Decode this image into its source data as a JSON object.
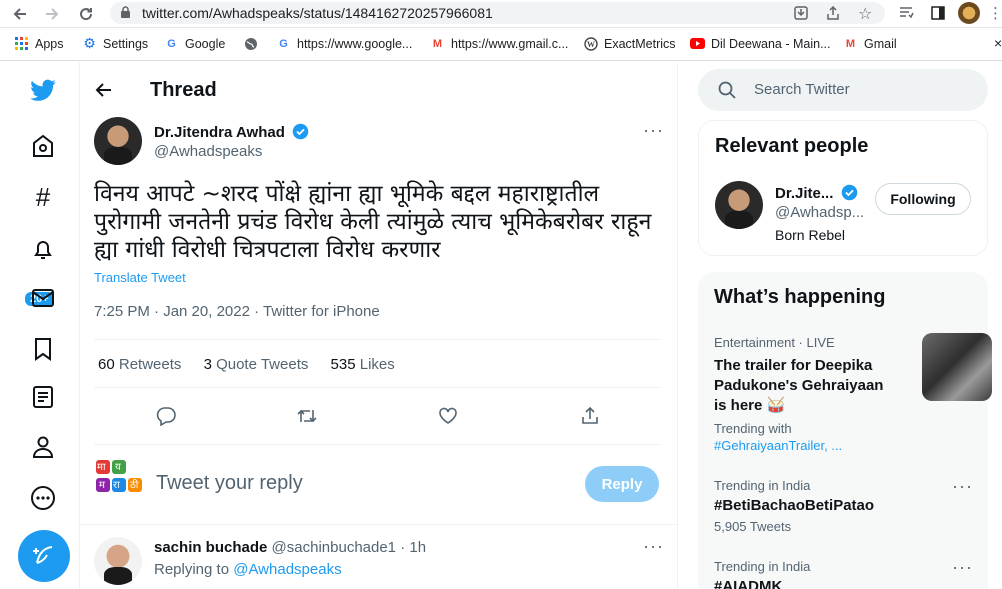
{
  "browser": {
    "url": "twitter.com/Awhadspeaks/status/1484162720257966081",
    "bookmarks": [
      {
        "label": "Apps",
        "icon": "apps-grid-icon"
      },
      {
        "label": "Settings",
        "icon": "gear-icon"
      },
      {
        "label": "Google",
        "icon": "google-icon"
      },
      {
        "label": "",
        "icon": "globe-icon"
      },
      {
        "label": "https://www.google...",
        "icon": "google-icon"
      },
      {
        "label": "https://www.gmail.c...",
        "icon": "gmail-icon"
      },
      {
        "label": "ExactMetrics",
        "icon": "wordpress-icon"
      },
      {
        "label": "Dil Deewana - Main...",
        "icon": "youtube-icon"
      },
      {
        "label": "Gmail",
        "icon": "gmail-icon"
      }
    ],
    "close_glyph": "×"
  },
  "nav": {
    "notifications_badge": "20+"
  },
  "thread": {
    "header_title": "Thread",
    "author_name": "Dr.Jitendra Awhad",
    "author_handle": "@Awhadspeaks",
    "more": "···",
    "text": "विनय आपटे ~शरद पोंक्षे ह्यांना ह्या भूमिके बद्दल महाराष्ट्रातील पुरोगामी जनतेनी प्रचंड विरोध केली त्यांमुळे त्याच भूमिकेबरोबर राहून ह्या गांधी विरोधी चित्रपटाला विरोध करणार",
    "translate": "Translate Tweet",
    "meta": "7:25 PM · Jan 20, 2022 · Twitter for iPhone",
    "retweets_count": "60",
    "retweets_label": "Retweets",
    "quotes_count": "3",
    "quotes_label": "Quote Tweets",
    "likes_count": "535",
    "likes_label": "Likes"
  },
  "compose": {
    "placeholder": "Tweet your reply",
    "reply_button": "Reply",
    "logo_letters": [
      "मा",
      "य",
      "म",
      "रा",
      "ठी"
    ]
  },
  "reply": {
    "name": "sachin buchade",
    "handle": "@sachinbuchade1",
    "time": "· 1h",
    "replying_to_label": "Replying to",
    "replying_to_handle": "@Awhadspeaks",
    "more": "···"
  },
  "sidebar": {
    "search_placeholder": "Search Twitter",
    "relevant_title": "Relevant people",
    "person_name": "Dr.Jite...",
    "person_handle": "@Awhadsp...",
    "person_bio": "Born Rebel",
    "follow_label": "Following",
    "happening_title": "What’s happening",
    "trends": [
      {
        "context": "Entertainment · LIVE",
        "title": "The trailer for Deepika Padukone's Gehraiyaan is here 🥁",
        "sub": "Trending with",
        "link": "#GehraiyaanTrailer, ..."
      },
      {
        "context": "Trending in India",
        "title": "#BetiBachaoBetiPatao",
        "sub": "5,905 Tweets"
      },
      {
        "context": "Trending in India",
        "title": "#AIADMK"
      }
    ],
    "more": "···"
  },
  "colors": {
    "accent": "#1d9bf0",
    "reply_disabled": "#8ecdf8"
  }
}
